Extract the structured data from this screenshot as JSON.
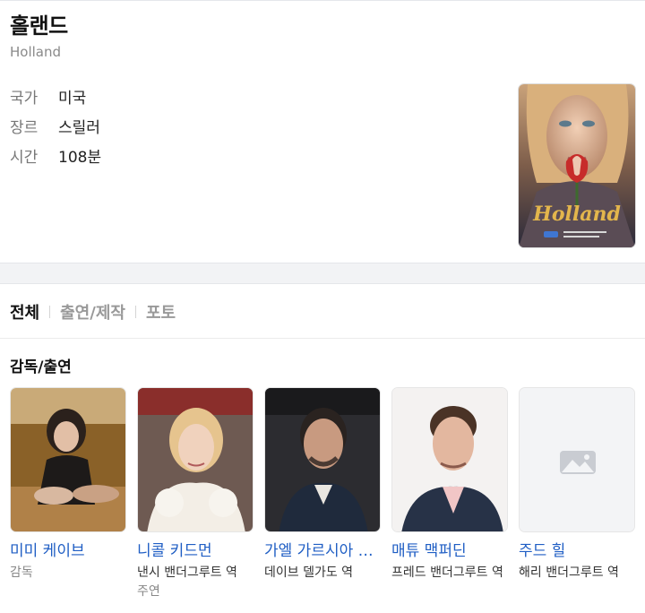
{
  "movie": {
    "title": "홀랜드",
    "original_title": "Holland",
    "info": [
      {
        "key": "국가",
        "value": "미국"
      },
      {
        "key": "장르",
        "value": "스릴러"
      },
      {
        "key": "시간",
        "value": "108분"
      }
    ],
    "poster_title": "Holland"
  },
  "tabs": [
    {
      "label": "전체",
      "active": true
    },
    {
      "label": "출연/제작",
      "active": false
    },
    {
      "label": "포토",
      "active": false
    }
  ],
  "section": {
    "title": "감독/출연"
  },
  "cast": [
    {
      "name": "미미 케이브",
      "role": "감독",
      "role2": ""
    },
    {
      "name": "니콜 키드먼",
      "role": "낸시 밴더그루트 역",
      "role2": "주연"
    },
    {
      "name": "가엘 가르시아 베르날",
      "role": "데이브 델가도 역",
      "role2": ""
    },
    {
      "name": "매튜 맥퍼딘",
      "role": "프레드 밴더그루트 역",
      "role2": ""
    },
    {
      "name": "주드 힐",
      "role": "해리 밴더그루트 역",
      "role2": ""
    }
  ],
  "colors": {
    "link": "#1f5ec4",
    "band": "#f2f3f5"
  }
}
